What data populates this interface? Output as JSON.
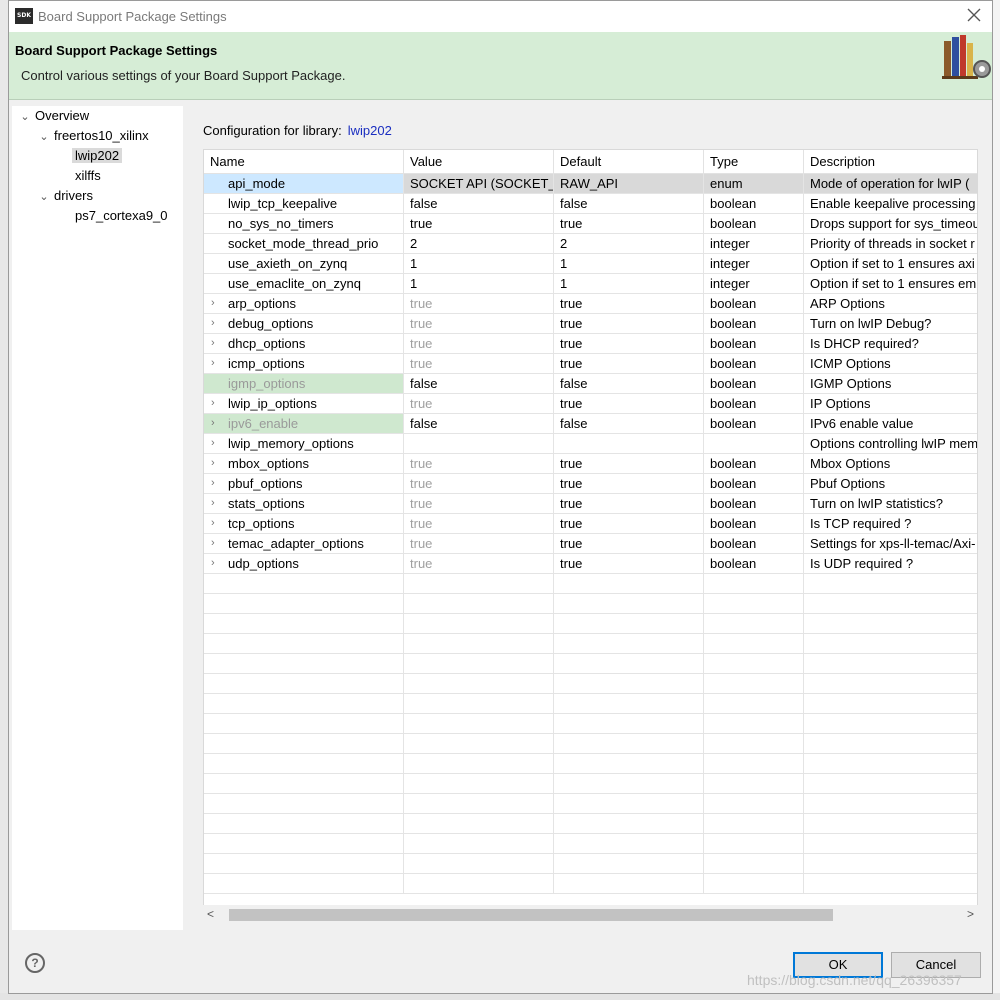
{
  "window": {
    "app_icon_text": "SDK",
    "title": "Board Support Package Settings"
  },
  "banner": {
    "title": "Board Support Package Settings",
    "subtitle": "Control various settings of your Board Support Package."
  },
  "nav": {
    "items": [
      {
        "label": "Overview",
        "expander": "⌄"
      },
      {
        "label": "freertos10_xilinx",
        "expander": "⌄"
      },
      {
        "label": "lwip202",
        "selected": true
      },
      {
        "label": "xilffs"
      },
      {
        "label": "drivers",
        "expander": "⌄"
      },
      {
        "label": "ps7_cortexa9_0"
      }
    ]
  },
  "config": {
    "label": "Configuration for library:",
    "library": "lwip202"
  },
  "table": {
    "headers": [
      "Name",
      "Value",
      "Default",
      "Type",
      "Description"
    ],
    "rows": [
      {
        "name": "api_mode",
        "value": "SOCKET API (SOCKET_...",
        "default": "RAW_API",
        "type": "enum",
        "description": "Mode of operation for lwIP (",
        "state": "selected"
      },
      {
        "name": "lwip_tcp_keepalive",
        "value": "false",
        "default": "false",
        "type": "boolean",
        "description": "Enable keepalive processing"
      },
      {
        "name": "no_sys_no_timers",
        "value": "true",
        "default": "true",
        "type": "boolean",
        "description": "Drops support for sys_timeou"
      },
      {
        "name": "socket_mode_thread_prio",
        "value": "2",
        "default": "2",
        "type": "integer",
        "description": "Priority of threads in socket r"
      },
      {
        "name": "use_axieth_on_zynq",
        "value": "1",
        "default": "1",
        "type": "integer",
        "description": "Option if set to 1 ensures axi"
      },
      {
        "name": "use_emaclite_on_zynq",
        "value": "1",
        "default": "1",
        "type": "integer",
        "description": "Option if set to 1 ensures em"
      },
      {
        "name": "arp_options",
        "value": "true",
        "default": "true",
        "type": "boolean",
        "description": "ARP Options",
        "expandable": true,
        "value_grey": true
      },
      {
        "name": "debug_options",
        "value": "true",
        "default": "true",
        "type": "boolean",
        "description": "Turn on lwIP Debug?",
        "expandable": true,
        "value_grey": true
      },
      {
        "name": "dhcp_options",
        "value": "true",
        "default": "true",
        "type": "boolean",
        "description": "Is DHCP required?",
        "expandable": true,
        "value_grey": true
      },
      {
        "name": "icmp_options",
        "value": "true",
        "default": "true",
        "type": "boolean",
        "description": "ICMP Options",
        "expandable": true,
        "value_grey": true
      },
      {
        "name": "igmp_options",
        "value": "false",
        "default": "false",
        "type": "boolean",
        "description": "IGMP Options",
        "state": "green"
      },
      {
        "name": "lwip_ip_options",
        "value": "true",
        "default": "true",
        "type": "boolean",
        "description": "IP Options",
        "expandable": true,
        "value_grey": true
      },
      {
        "name": "ipv6_enable",
        "value": "false",
        "default": "false",
        "type": "boolean",
        "description": "IPv6 enable value",
        "expandable": true,
        "state": "green"
      },
      {
        "name": "lwip_memory_options",
        "value": "",
        "default": "",
        "type": "",
        "description": "Options controlling lwIP mem",
        "expandable": true
      },
      {
        "name": "mbox_options",
        "value": "true",
        "default": "true",
        "type": "boolean",
        "description": "Mbox Options",
        "expandable": true,
        "value_grey": true
      },
      {
        "name": "pbuf_options",
        "value": "true",
        "default": "true",
        "type": "boolean",
        "description": "Pbuf Options",
        "expandable": true,
        "value_grey": true
      },
      {
        "name": "stats_options",
        "value": "true",
        "default": "true",
        "type": "boolean",
        "description": "Turn on lwIP statistics?",
        "expandable": true,
        "value_grey": true
      },
      {
        "name": "tcp_options",
        "value": "true",
        "default": "true",
        "type": "boolean",
        "description": "Is TCP required ?",
        "expandable": true,
        "value_grey": true
      },
      {
        "name": "temac_adapter_options",
        "value": "true",
        "default": "true",
        "type": "boolean",
        "description": "Settings for xps-ll-temac/Axi-",
        "expandable": true,
        "value_grey": true
      },
      {
        "name": "udp_options",
        "value": "true",
        "default": "true",
        "type": "boolean",
        "description": "Is UDP required ?",
        "expandable": true,
        "value_grey": true
      }
    ],
    "empty_rows": 16
  },
  "scrollbar": {
    "left_arrow": "<",
    "right_arrow": ">"
  },
  "footer": {
    "help_icon": "?",
    "ok_label": "OK",
    "cancel_label": "Cancel",
    "watermark": "https://blog.csdn.net/qq_26396357"
  },
  "icons": {
    "close": "close-icon",
    "help": "help-icon",
    "banner": "books-gear-icon"
  }
}
